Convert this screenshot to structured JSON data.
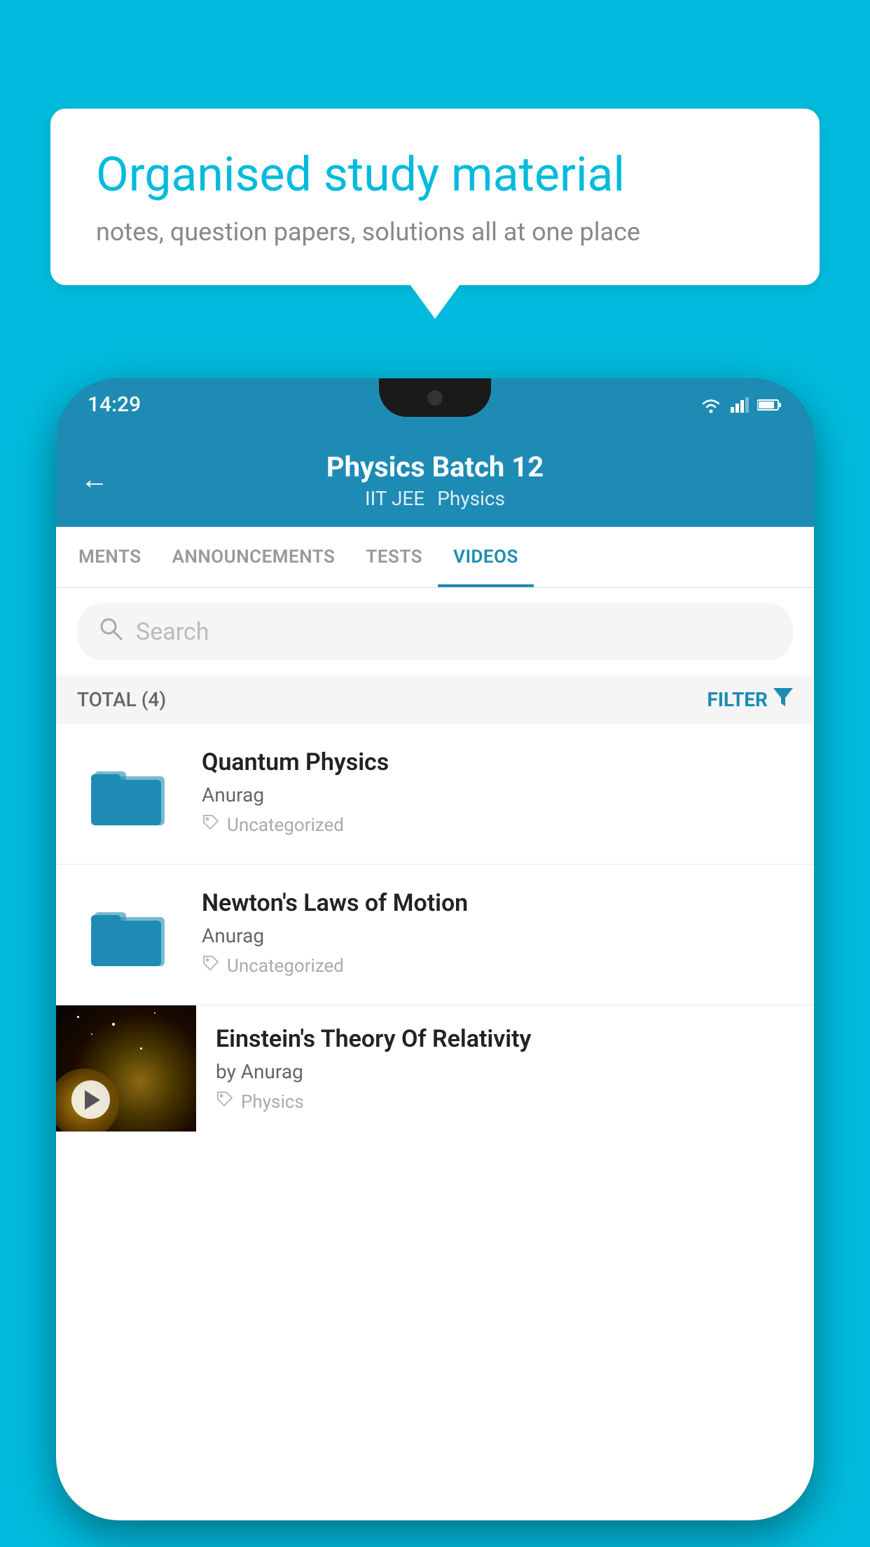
{
  "page": {
    "bg_color": "#00BBDD"
  },
  "speech_bubble": {
    "title": "Organised study material",
    "subtitle": "notes, question papers, solutions all at one place"
  },
  "status_bar": {
    "time": "14:29",
    "wifi": "▼",
    "signal": "▲",
    "battery": "▌"
  },
  "app_header": {
    "back_icon": "←",
    "title": "Physics Batch 12",
    "tag1": "IIT JEE",
    "tag2": "Physics"
  },
  "tabs": [
    {
      "label": "MENTS",
      "active": false
    },
    {
      "label": "ANNOUNCEMENTS",
      "active": false
    },
    {
      "label": "TESTS",
      "active": false
    },
    {
      "label": "VIDEOS",
      "active": true
    }
  ],
  "search": {
    "placeholder": "Search"
  },
  "filter_row": {
    "total_label": "TOTAL (4)",
    "filter_label": "FILTER",
    "filter_icon": "▼"
  },
  "videos": [
    {
      "title": "Quantum Physics",
      "author": "Anurag",
      "tag": "Uncategorized",
      "type": "folder"
    },
    {
      "title": "Newton's Laws of Motion",
      "author": "Anurag",
      "tag": "Uncategorized",
      "type": "folder"
    },
    {
      "title": "Einstein's Theory Of Relativity",
      "author": "by Anurag",
      "tag": "Physics",
      "type": "video"
    }
  ]
}
